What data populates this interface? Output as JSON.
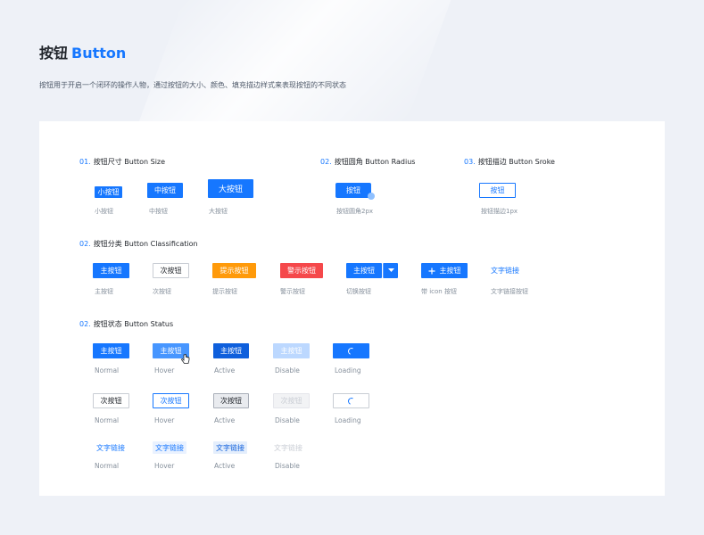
{
  "header": {
    "title_cn": "按钮",
    "title_en": "Button",
    "desc": "按钮用于开启一个闭环的操作人物，通过按钮的大小、颜色、填充描边样式来表现按钮的不同状态"
  },
  "sections": {
    "size": {
      "num": "01.",
      "label": "按钮尺寸 Button Size"
    },
    "radius": {
      "num": "02.",
      "label": "按钮圆角 Button Radius"
    },
    "stroke": {
      "num": "03.",
      "label": "按钮描边 Button Sroke"
    },
    "classification": {
      "num": "02.",
      "label": "按钮分类 Button Classification"
    },
    "status": {
      "num": "02.",
      "label": "按钮状态 Button Status"
    }
  },
  "size": {
    "small": {
      "label": "小按钮",
      "caption": "小按钮"
    },
    "medium": {
      "label": "中按钮",
      "caption": "中按钮"
    },
    "large": {
      "label": "大按钮",
      "caption": "大按钮"
    }
  },
  "radius": {
    "label": "按钮",
    "caption": "按钮圆角2px"
  },
  "stroke": {
    "label": "按钮",
    "caption": "按钮描边1px"
  },
  "classification": {
    "primary": {
      "label": "主按钮",
      "caption": "主按钮"
    },
    "secondary": {
      "label": "次按钮",
      "caption": "次按钮"
    },
    "warning": {
      "label": "提示按钮",
      "caption": "提示按钮"
    },
    "danger": {
      "label": "警示按钮",
      "caption": "警示按钮"
    },
    "split": {
      "label": "主按钮",
      "caption": "切换按钮"
    },
    "icon": {
      "label": "主按钮",
      "caption": "带 icon 按钮"
    },
    "text": {
      "label": "文字链接",
      "caption": "文字链接按钮"
    }
  },
  "status": {
    "states": [
      "Normal",
      "Hover",
      "Active",
      "Disable",
      "Loading"
    ],
    "primary_label": "主按钮",
    "secondary_label": "次按钮",
    "text_label": "文字链接",
    "text_states": [
      "Normal",
      "Hover",
      "Active",
      "Disable"
    ]
  },
  "colors": {
    "brand": "#1677ff",
    "warning": "#ff9a0a",
    "danger": "#f5484b"
  }
}
